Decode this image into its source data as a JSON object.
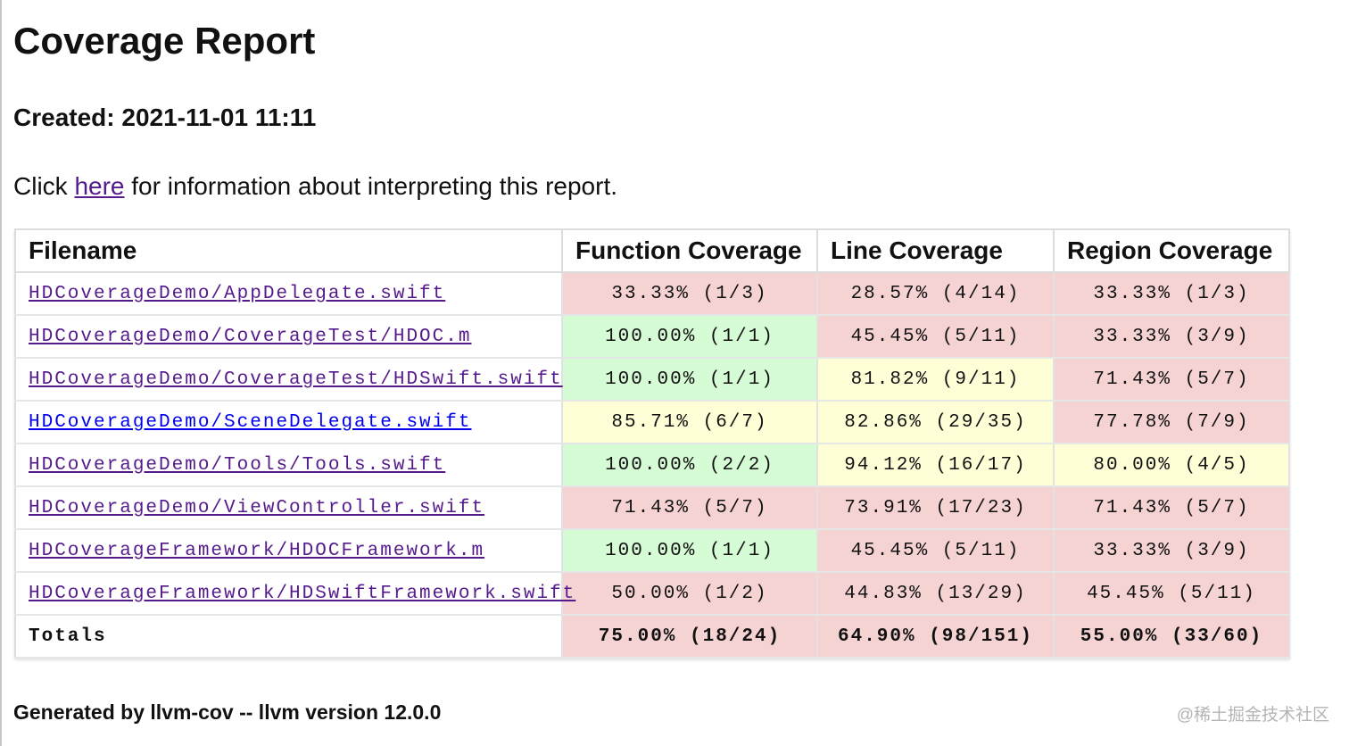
{
  "title": "Coverage Report",
  "created": "Created: 2021-11-01 11:11",
  "info": {
    "before": "Click ",
    "link": "here",
    "after": " for information about interpreting this report."
  },
  "colors": {
    "low": "#f6d3d3",
    "medium": "#ffffd7",
    "high": "#d6fcd6",
    "link": "#551a8b",
    "link_highlighted": "#0000ee"
  },
  "table": {
    "headers": [
      "Filename",
      "Function Coverage",
      "Line Coverage",
      "Region Coverage"
    ],
    "rows": [
      {
        "file": "HDCoverageDemo/AppDelegate.swift",
        "function": "33.33% (1/3)",
        "line": "28.57% (4/14)",
        "region": "33.33% (1/3)"
      },
      {
        "file": "HDCoverageDemo/CoverageTest/HDOC.m",
        "function": "100.00% (1/1)",
        "line": "45.45% (5/11)",
        "region": "33.33% (3/9)"
      },
      {
        "file": "HDCoverageDemo/CoverageTest/HDSwift.swift",
        "function": "100.00% (1/1)",
        "line": "81.82% (9/11)",
        "region": "71.43% (5/7)"
      },
      {
        "file": "HDCoverageDemo/SceneDelegate.swift",
        "function": "85.71% (6/7)",
        "line": "82.86% (29/35)",
        "region": "77.78% (7/9)"
      },
      {
        "file": "HDCoverageDemo/Tools/Tools.swift",
        "function": "100.00% (2/2)",
        "line": "94.12% (16/17)",
        "region": "80.00% (4/5)"
      },
      {
        "file": "HDCoverageDemo/ViewController.swift",
        "function": "71.43% (5/7)",
        "line": "73.91% (17/23)",
        "region": "71.43% (5/7)"
      },
      {
        "file": "HDCoverageFramework/HDOCFramework.m",
        "function": "100.00% (1/1)",
        "line": "45.45% (5/11)",
        "region": "33.33% (3/9)"
      },
      {
        "file": "HDCoverageFramework/HDSwiftFramework.swift",
        "function": "50.00% (1/2)",
        "line": "44.83% (13/29)",
        "region": "45.45% (5/11)"
      }
    ],
    "totals": {
      "label": "Totals",
      "function": "75.00% (18/24)",
      "line": "64.90% (98/151)",
      "region": "55.00% (33/60)"
    }
  },
  "footer": "Generated by llvm-cov -- llvm version 12.0.0",
  "watermark": "@稀土掘金技术社区"
}
